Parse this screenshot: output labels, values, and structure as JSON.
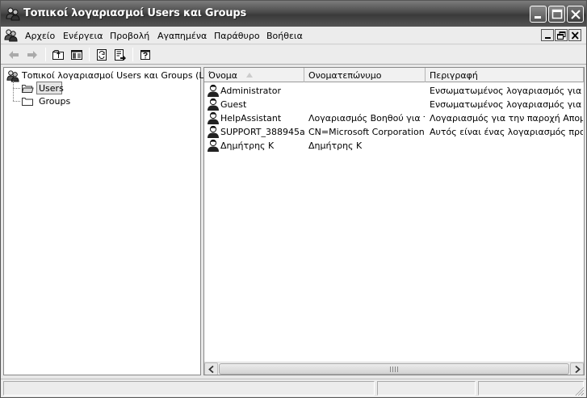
{
  "window": {
    "title": "Τοπικοί λογαριασμοί Users και Groups",
    "app_icon": "users-groups-icon"
  },
  "menubar": {
    "items": [
      "Αρχείο",
      "Ενέργεια",
      "Προβολή",
      "Αγαπημένα",
      "Παράθυρο",
      "Βοήθεια"
    ]
  },
  "toolbar": {
    "buttons": [
      "back-arrow-icon",
      "forward-arrow-icon",
      "up-folder-icon",
      "show-hide-tree-icon",
      "refresh-icon",
      "export-list-icon",
      "properties-help-icon"
    ]
  },
  "tree": {
    "root": "Τοπικοί λογαριασμοί Users και Groups (Local)",
    "children": [
      {
        "label": "Users",
        "selected": true
      },
      {
        "label": "Groups",
        "selected": false
      }
    ]
  },
  "list": {
    "columns": [
      "Όνομα",
      "Ονοματεπώνυμο",
      "Περιγραφή"
    ],
    "sorted_by": "Όνομα",
    "rows": [
      {
        "name": "Administrator",
        "full_name": "",
        "description": "Ενσωματωμένος λογαριασμός για τη..."
      },
      {
        "name": "Guest",
        "full_name": "",
        "description": "Ενσωματωμένος λογαριασμός για πρ..."
      },
      {
        "name": "HelpAssistant",
        "full_name": "Λογαριασμός Βοηθού για τ...",
        "description": "Λογαριασμός για την παροχή Απομα..."
      },
      {
        "name": "SUPPORT_388945a0",
        "full_name": "CN=Microsoft Corporation...",
        "description": "Αυτός είναι ένας λογαριασμός προμη..."
      },
      {
        "name": "Δημήτρης Κ",
        "full_name": "Δημήτρης Κ",
        "description": ""
      }
    ]
  }
}
